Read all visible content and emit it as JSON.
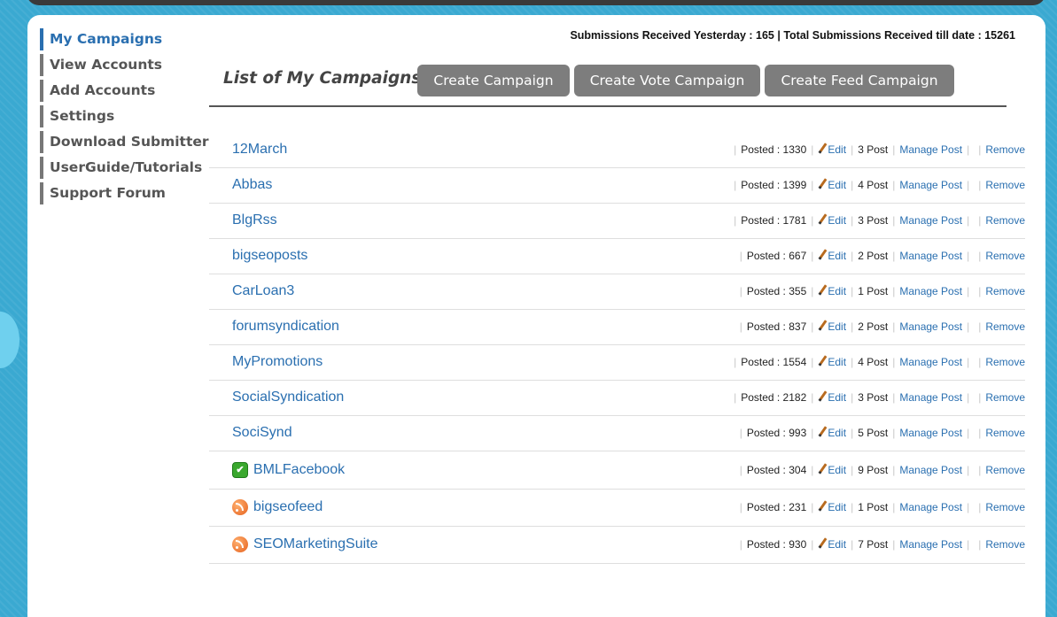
{
  "sidebar": {
    "items": [
      {
        "label": "My Campaigns",
        "active": true
      },
      {
        "label": "View Accounts"
      },
      {
        "label": "Add Accounts"
      },
      {
        "label": "Settings"
      },
      {
        "label": "Download Submitter"
      },
      {
        "label": "UserGuide/Tutorials"
      },
      {
        "label": "Support Forum"
      }
    ]
  },
  "stats": {
    "text": "Submissions Received Yesterday : 165 | Total Submissions Received till date : 15261"
  },
  "main": {
    "heading": "List of My Campaigns :",
    "buttons": {
      "create": "Create Campaign",
      "vote": "Create Vote Campaign",
      "feed": "Create Feed Campaign"
    }
  },
  "labels": {
    "edit": "Edit",
    "manage": "Manage Post",
    "remove": "Remove"
  },
  "colors": {
    "accent": "#2a6fb0",
    "button": "#7d7d7d",
    "background": "#3aa9d1"
  },
  "campaigns": [
    {
      "name": "12March",
      "posted": "Posted : 1330",
      "posts": "3 Post"
    },
    {
      "name": "Abbas",
      "posted": "Posted : 1399",
      "posts": "4 Post"
    },
    {
      "name": "BlgRss",
      "posted": "Posted : 1781",
      "posts": "3 Post"
    },
    {
      "name": "bigseoposts",
      "posted": "Posted : 667",
      "posts": "2 Post"
    },
    {
      "name": "CarLoan3",
      "posted": "Posted : 355",
      "posts": "1 Post"
    },
    {
      "name": "forumsyndication",
      "posted": "Posted : 837",
      "posts": "2 Post"
    },
    {
      "name": "MyPromotions",
      "posted": "Posted : 1554",
      "posts": "4 Post"
    },
    {
      "name": "SocialSyndication",
      "posted": "Posted : 2182",
      "posts": "3 Post"
    },
    {
      "name": "SociSynd",
      "posted": "Posted : 993",
      "posts": "5 Post"
    },
    {
      "name": "BMLFacebook",
      "posted": "Posted : 304",
      "posts": "9 Post",
      "icon": "facebook-like-icon"
    },
    {
      "name": "bigseofeed",
      "posted": "Posted : 231",
      "posts": "1 Post",
      "icon": "rss-icon"
    },
    {
      "name": "SEOMarketingSuite",
      "posted": "Posted : 930",
      "posts": "7 Post",
      "icon": "rss-icon"
    }
  ]
}
